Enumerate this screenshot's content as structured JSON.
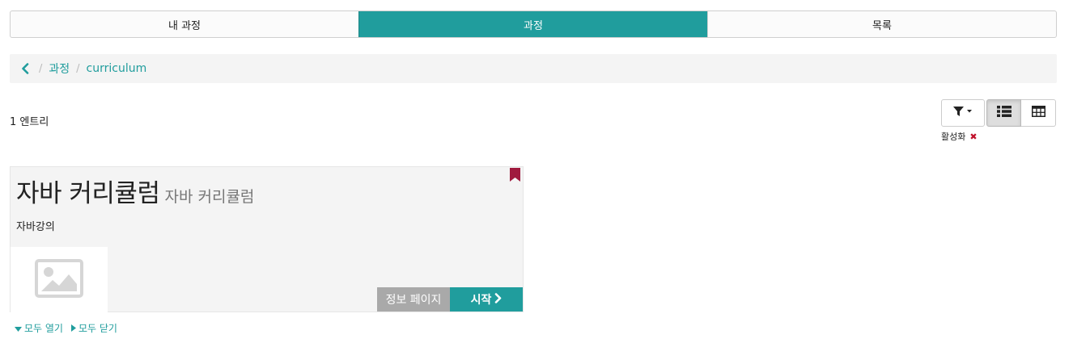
{
  "tabs": [
    {
      "label": "내 과정",
      "active": false
    },
    {
      "label": "과정",
      "active": true
    },
    {
      "label": "목록",
      "active": false
    }
  ],
  "breadcrumb": {
    "back_icon": "chevron-left-icon",
    "items": [
      "과정",
      "curriculum"
    ]
  },
  "results": {
    "count_text": "1 엔트리"
  },
  "toolbar": {
    "filter_icon": "filter-icon",
    "view_list_icon": "list-view-icon",
    "view_table_icon": "table-view-icon",
    "active_view": "list"
  },
  "active_filter": {
    "label": "활성화",
    "remove_icon": "remove-filter-icon"
  },
  "card": {
    "title": "자바 커리큘럼",
    "subtitle": "자바 커리큘럼",
    "description": "자바강의",
    "bookmark_icon": "bookmark-icon",
    "thumbnail_icon": "image-placeholder-icon",
    "info_button": "정보 페이지",
    "start_button": "시작"
  },
  "expand": {
    "open_all": "모두 열기",
    "close_all": "모두 닫기"
  },
  "colors": {
    "accent": "#209d9d",
    "bookmark": "#a01a3e",
    "remove": "#c0102a"
  }
}
